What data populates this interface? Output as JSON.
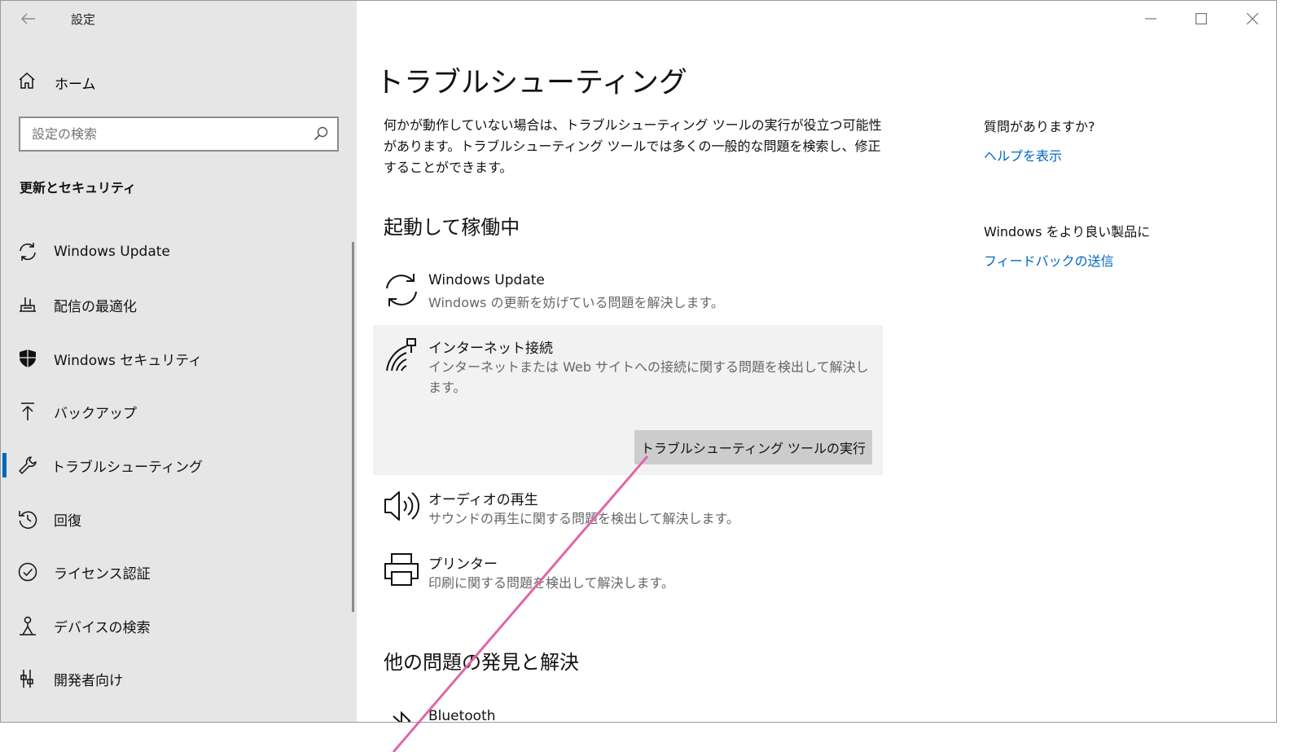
{
  "window": {
    "title": "設定"
  },
  "sidebar": {
    "home_label": "ホーム",
    "search_placeholder": "設定の検索",
    "section_title": "更新とセキュリティ",
    "items": [
      {
        "label": "Windows Update",
        "icon": "sync-icon"
      },
      {
        "label": "配信の最適化",
        "icon": "delivery-optimization-icon"
      },
      {
        "label": "Windows セキュリティ",
        "icon": "shield-icon"
      },
      {
        "label": "バックアップ",
        "icon": "backup-arrow-icon"
      },
      {
        "label": "トラブルシューティング",
        "icon": "wrench-icon",
        "active": true
      },
      {
        "label": "回復",
        "icon": "recovery-icon"
      },
      {
        "label": "ライセンス認証",
        "icon": "check-circle-icon"
      },
      {
        "label": "デバイスの検索",
        "icon": "find-device-icon"
      },
      {
        "label": "開発者向け",
        "icon": "developer-tools-icon"
      }
    ]
  },
  "main": {
    "title": "トラブルシューティング",
    "description": "何かが動作していない場合は、トラブルシューティング ツールの実行が役立つ可能性があります。トラブルシューティング ツールでは多くの一般的な問題を検索し、修正することができます。",
    "section_running": "起動して稼働中",
    "items": [
      {
        "name": "Windows Update",
        "desc": "Windows の更新を妨げている問題を解決します。",
        "icon": "sync-icon"
      },
      {
        "name": "インターネット接続",
        "desc": "インターネットまたは Web サイトへの接続に関する問題を検出して解決します。",
        "icon": "wifi-network-icon"
      },
      {
        "name": "オーディオの再生",
        "desc": "サウンドの再生に関する問題を検出して解決します。",
        "icon": "speaker-icon"
      },
      {
        "name": "プリンター",
        "desc": "印刷に関する問題を検出して解決します。",
        "icon": "printer-icon"
      }
    ],
    "run_button_label": "トラブルシューティング ツールの実行",
    "section_other": "他の問題の発見と解決",
    "other_items": [
      {
        "name": "Bluetooth",
        "icon": "bluetooth-icon"
      }
    ]
  },
  "right": {
    "question": "質問がありますか?",
    "help_link": "ヘルプを表示",
    "improve_text": "Windows をより良い製品に",
    "feedback_link": "フィードバックの送信"
  },
  "colors": {
    "accent": "#0067c0",
    "sidebar_bg": "#e6e6e6",
    "annotation_line": "#e066a8"
  }
}
